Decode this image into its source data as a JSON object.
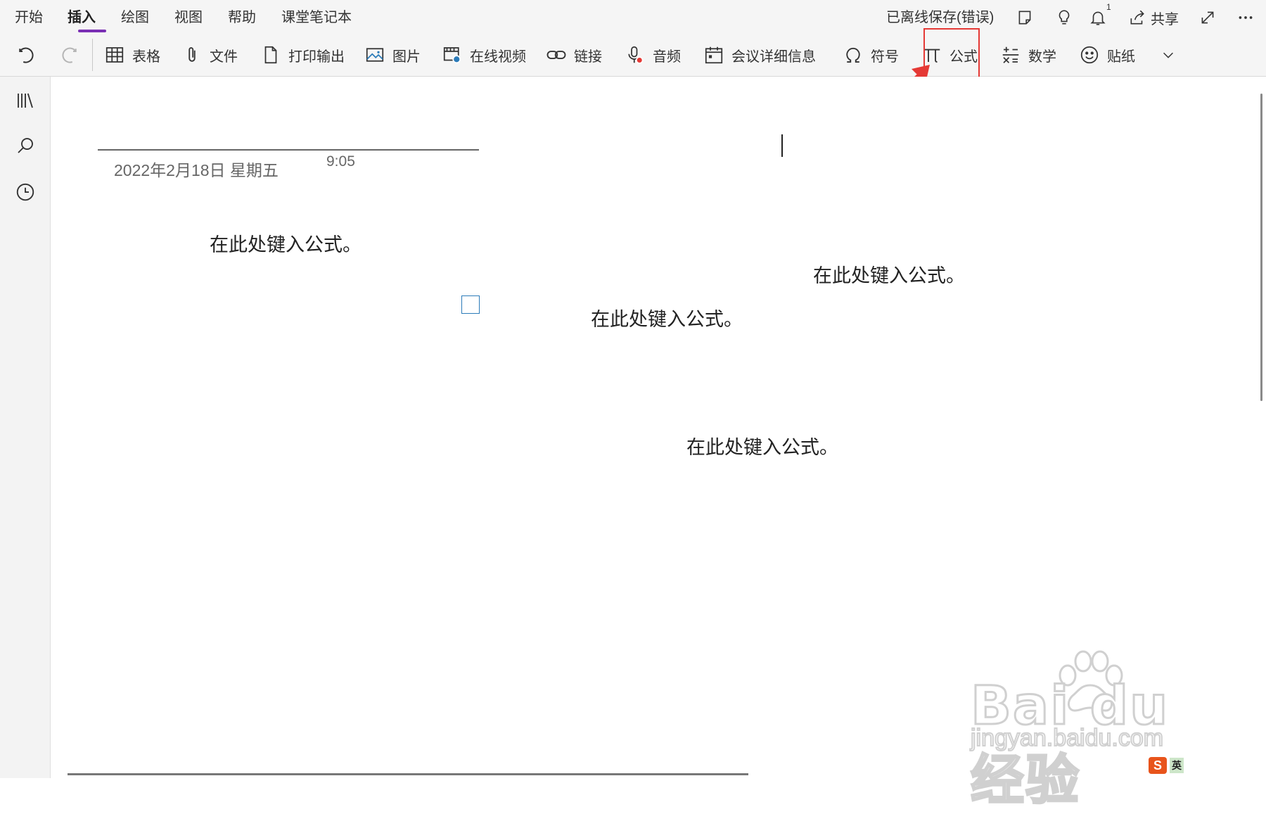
{
  "menu_tabs": [
    "开始",
    "插入",
    "绘图",
    "视图",
    "帮助",
    "课堂笔记本"
  ],
  "status_text": "已离线保存(错误)",
  "notification_count": "1",
  "share_label": "共享",
  "toolbar": {
    "table": "表格",
    "file": "文件",
    "printout": "打印输出",
    "picture": "图片",
    "online_video": "在线视频",
    "link": "链接",
    "audio": "音频",
    "meeting_details": "会议详细信息",
    "symbol": "符号",
    "equation": "公式",
    "math": "数学",
    "sticker": "贴纸"
  },
  "page": {
    "date": "2022年2月18日 星期五",
    "time": "9:05",
    "equations": [
      "在此处键入公式。",
      "在此处键入公式。",
      "在此处键入公式。",
      "在此处键入公式。"
    ]
  },
  "watermark": {
    "brand": "Bai du经验",
    "url": "jingyan.baidu.com"
  },
  "ime": {
    "label": "英"
  },
  "colors": {
    "accent": "#7a2fb4",
    "highlight": "#e53935"
  }
}
